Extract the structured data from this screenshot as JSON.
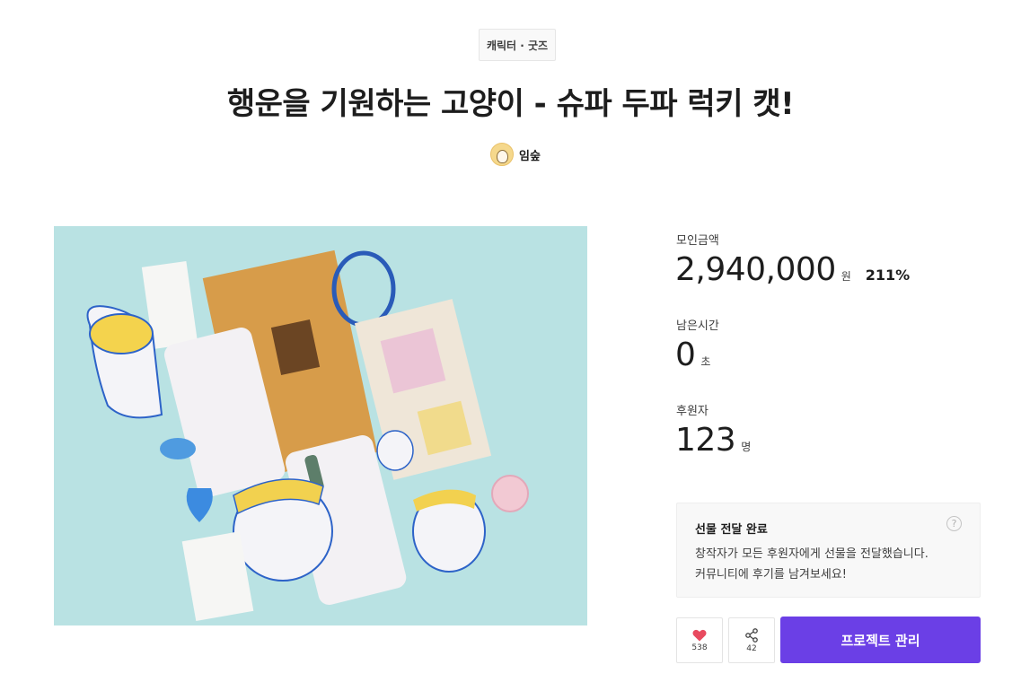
{
  "category": "캐릭터 · 굿즈",
  "title": "행운을 기원하는 고양이 - 슈파 두파 럭키 캣!",
  "creator": {
    "name": "임숲"
  },
  "stats": {
    "funded": {
      "label": "모인금액",
      "value": "2,940,000",
      "unit": "원",
      "percent": "211%"
    },
    "time_left": {
      "label": "남은시간",
      "value": "0",
      "unit": "초"
    },
    "backers": {
      "label": "후원자",
      "value": "123",
      "unit": "명"
    }
  },
  "notice": {
    "title": "선물 전달 완료",
    "line1": "창작자가 모든 후원자에게 선물을 전달했습니다.",
    "line2": "커뮤니티에 후기를 남겨보세요!",
    "help_icon": "?"
  },
  "actions": {
    "like_count": "538",
    "share_count": "42",
    "manage_label": "프로젝트 관리"
  },
  "colors": {
    "primary": "#6b3fe6",
    "like": "#e84a5f",
    "image_background": "#b9e2e3"
  }
}
